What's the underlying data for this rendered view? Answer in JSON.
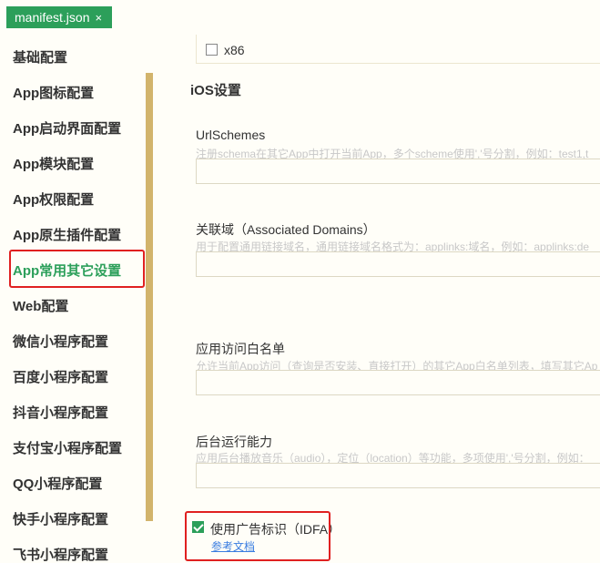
{
  "tab": {
    "title": "manifest.json",
    "close_glyph": "×"
  },
  "sidebar": {
    "items": [
      {
        "label": "基础配置"
      },
      {
        "label": "App图标配置"
      },
      {
        "label": "App启动界面配置"
      },
      {
        "label": "App模块配置"
      },
      {
        "label": "App权限配置"
      },
      {
        "label": "App原生插件配置"
      },
      {
        "label": "App常用其它设置",
        "active": true
      },
      {
        "label": "Web配置"
      },
      {
        "label": "微信小程序配置"
      },
      {
        "label": "百度小程序配置"
      },
      {
        "label": "抖音小程序配置"
      },
      {
        "label": "支付宝小程序配置"
      },
      {
        "label": "QQ小程序配置"
      },
      {
        "label": "快手小程序配置"
      },
      {
        "label": "飞书小程序配置"
      }
    ]
  },
  "main": {
    "x86_label": "x86",
    "ios_title": "iOS设置",
    "url_schemes": {
      "label": "UrlSchemes",
      "hint": "注册schema在其它App中打开当前App，多个scheme使用','号分割，例如：test1,t",
      "value": ""
    },
    "associated_domains": {
      "label": "关联域（Associated Domains）",
      "hint": "用于配置通用链接域名，通用链接域名格式为：applinks:域名，例如：applinks:de",
      "value": ""
    },
    "whitelist": {
      "label": "应用访问白名单",
      "hint": "允许当前App访问（查询是否安装、直接打开）的其它App白名单列表，填写其它Ap",
      "value": ""
    },
    "background": {
      "label": "后台运行能力",
      "hint": "应用后台播放音乐（audio），定位（location）等功能，多项使用','号分割，例如：",
      "value": ""
    },
    "idfa": {
      "label": "使用广告标识（IDFA）",
      "checked": true,
      "link": "参考文档"
    }
  },
  "colors": {
    "accent": "#2c9f5a",
    "highlight": "#e02020",
    "scrollbar": "#d2b46c",
    "link": "#3a7de0"
  }
}
